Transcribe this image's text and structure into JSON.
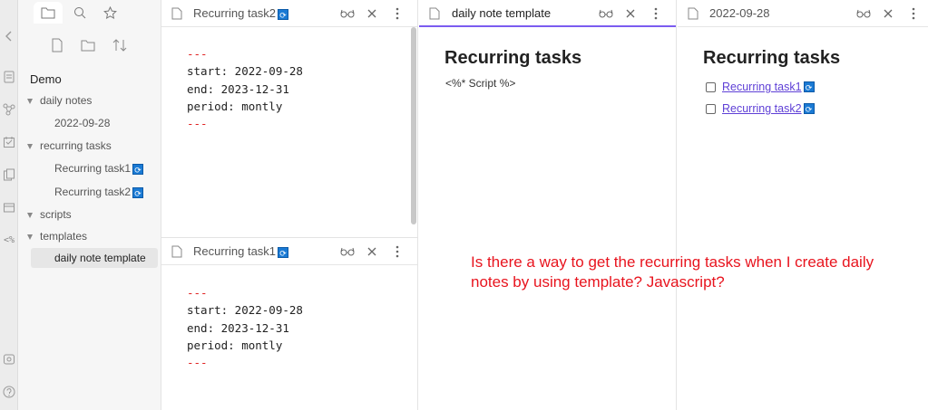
{
  "sidebar": {
    "root": "Demo",
    "items": [
      {
        "label": "daily notes",
        "kind": "folder"
      },
      {
        "label": "2022-09-28",
        "kind": "file"
      },
      {
        "label": "recurring tasks",
        "kind": "folder"
      },
      {
        "label": "Recurring task1",
        "kind": "file"
      },
      {
        "label": "Recurring task2",
        "kind": "file"
      },
      {
        "label": "scripts",
        "kind": "folder"
      },
      {
        "label": "templates",
        "kind": "folder"
      },
      {
        "label": "daily note template",
        "kind": "file",
        "active": true
      }
    ]
  },
  "pane_task2": {
    "title": "Recurring task2",
    "fm_dash_top": "---",
    "fm_start": "start: 2022-09-28",
    "fm_end": "end: 2023-12-31",
    "fm_period": "period: montly",
    "fm_dash_bottom": "---"
  },
  "pane_task1": {
    "title": "Recurring task1",
    "fm_dash_top": "---",
    "fm_start": "start: 2022-09-28",
    "fm_end": "end: 2023-12-31",
    "fm_period": "period: montly",
    "fm_dash_bottom": "---"
  },
  "pane_template": {
    "title": "daily note template",
    "heading": "Recurring tasks",
    "body": "<%* Script %>"
  },
  "pane_daily": {
    "title": "2022-09-28",
    "heading": "Recurring tasks",
    "tasks": [
      "Recurring task1",
      "Recurring task2"
    ]
  },
  "question": "Is there a way to get the recurring tasks when I create daily notes by using template? Javascript?",
  "colors": {
    "accent": "#7b5cf0",
    "question": "#e8141e",
    "link": "#5e3fd6",
    "dash": "#e02020",
    "recurring_icon": "#1a7ad4"
  }
}
